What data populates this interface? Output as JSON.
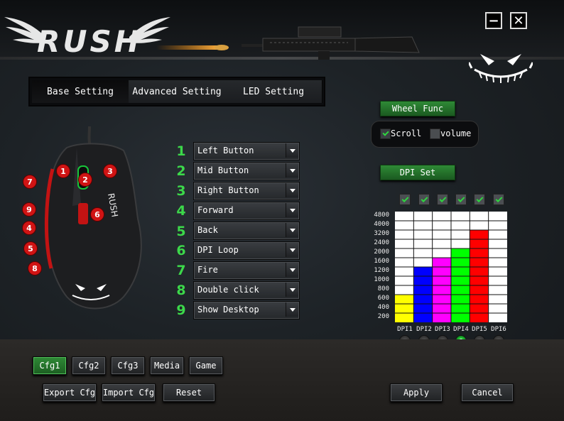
{
  "app": {
    "logo": "RUSH"
  },
  "window": {
    "minimize_icon": "minimize-icon",
    "close_icon": "close-icon"
  },
  "tabs": [
    {
      "label": "Base Setting",
      "active": true
    },
    {
      "label": "Advanced Setting",
      "active": false
    },
    {
      "label": "LED Setting",
      "active": false
    }
  ],
  "buttons": [
    {
      "num": "1",
      "function": "Left Button"
    },
    {
      "num": "2",
      "function": "Mid Button"
    },
    {
      "num": "3",
      "function": "Right Button"
    },
    {
      "num": "4",
      "function": "Forward"
    },
    {
      "num": "5",
      "function": "Back"
    },
    {
      "num": "6",
      "function": "DPI Loop"
    },
    {
      "num": "7",
      "function": "Fire"
    },
    {
      "num": "8",
      "function": "Double click"
    },
    {
      "num": "9",
      "function": "Show Desktop"
    }
  ],
  "mouse_badges": [
    "1",
    "2",
    "3",
    "4",
    "5",
    "6",
    "7",
    "8",
    "9"
  ],
  "wheel": {
    "title": "Wheel Func",
    "scroll_label": "Scroll",
    "scroll_checked": true,
    "volume_label": "volume",
    "volume_checked": false
  },
  "dpi": {
    "title": "DPI Set",
    "ticks": [
      "4800",
      "4000",
      "3200",
      "2400",
      "2000",
      "1600",
      "1200",
      "1000",
      "800",
      "600",
      "400",
      "200"
    ],
    "levels": [
      {
        "label": "DPI1",
        "value": 600,
        "color": "#ffff00",
        "enabled": true,
        "selected": false
      },
      {
        "label": "DPI2",
        "value": 1200,
        "color": "#0000ff",
        "enabled": true,
        "selected": false
      },
      {
        "label": "DPI3",
        "value": 1600,
        "color": "#ff00ff",
        "enabled": true,
        "selected": false
      },
      {
        "label": "DPI4",
        "value": 2000,
        "color": "#00ff00",
        "enabled": true,
        "selected": true
      },
      {
        "label": "DPI5",
        "value": 3200,
        "color": "#ff0000",
        "enabled": true,
        "selected": false
      },
      {
        "label": "DPI6",
        "value": 4800,
        "color": "#ffffff",
        "enabled": true,
        "selected": false
      }
    ]
  },
  "configs": [
    {
      "label": "Cfg1",
      "active": true
    },
    {
      "label": "Cfg2",
      "active": false
    },
    {
      "label": "Cfg3",
      "active": false
    },
    {
      "label": "Media",
      "active": false
    },
    {
      "label": "Game",
      "active": false
    }
  ],
  "actions": {
    "export": "Export Cfg",
    "import": "Import Cfg",
    "reset": "Reset",
    "apply": "Apply",
    "cancel": "Cancel"
  }
}
